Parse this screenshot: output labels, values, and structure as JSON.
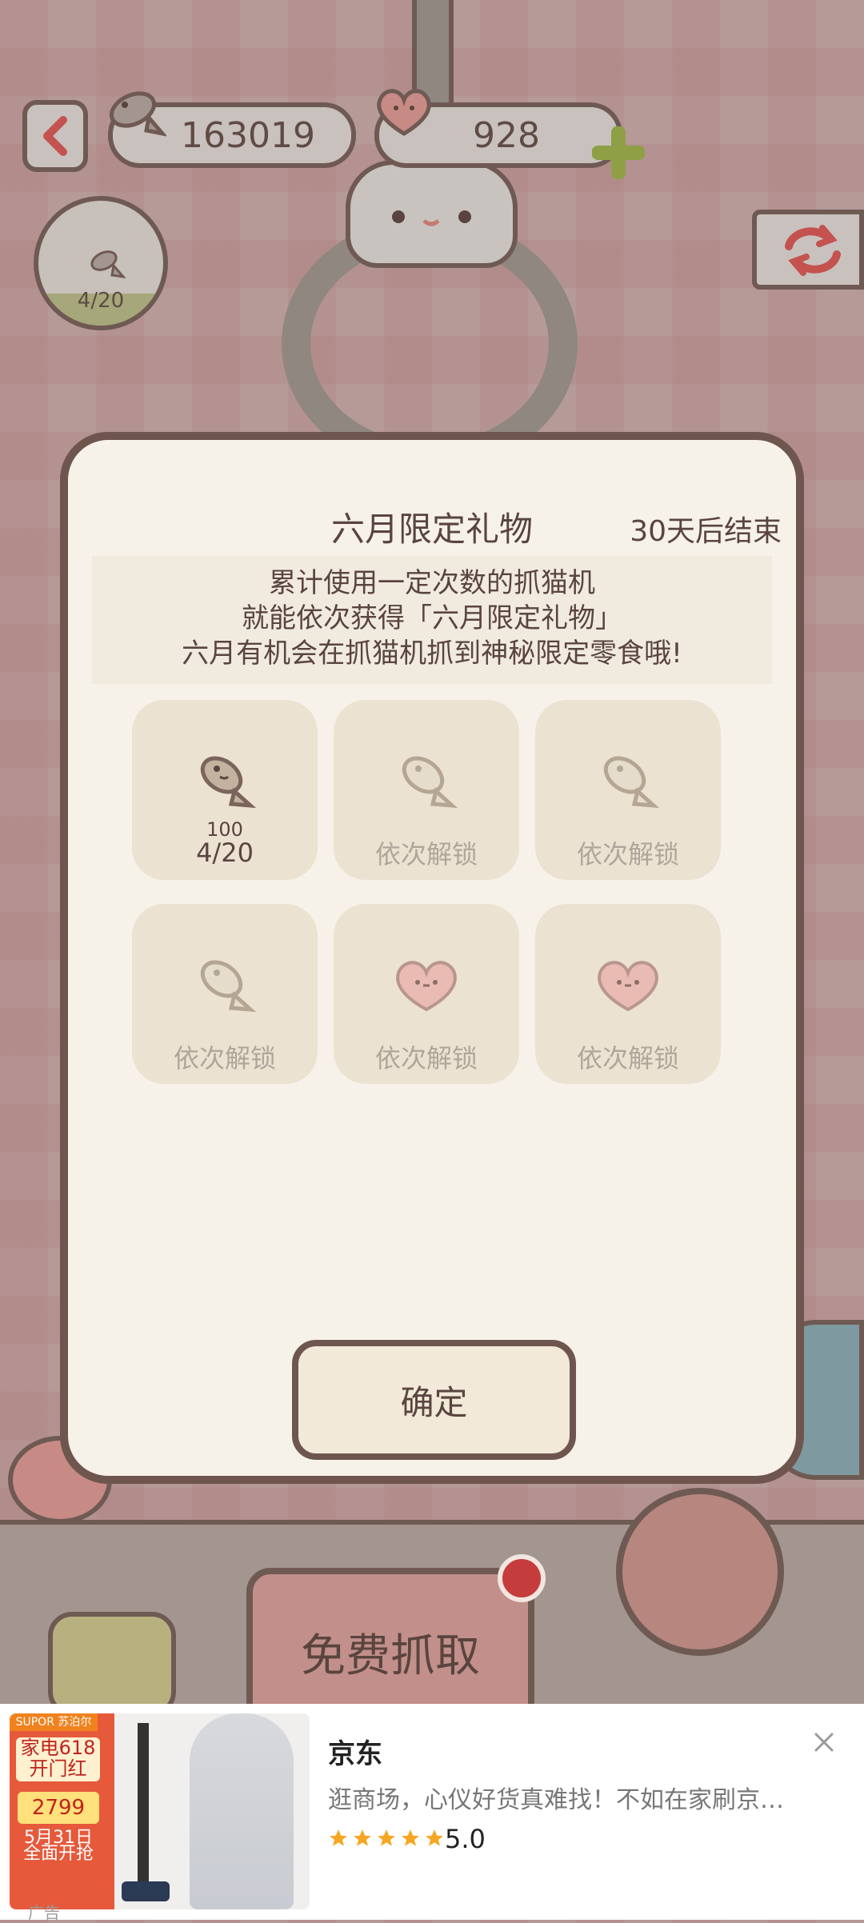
{
  "hud": {
    "fish_count": "163019",
    "heart_count": "928",
    "progress_text": "4/20"
  },
  "modal": {
    "title": "六月限定礼物",
    "timer": "30天后结束",
    "description": [
      "累计使用一定次数的抓猫机",
      "就能依次获得「六月限定礼物」",
      "六月有机会在抓猫机抓到神秘限定零食哦!"
    ],
    "rewards": [
      {
        "icon": "fish-icon",
        "line1": "100",
        "line2": "4/20",
        "state": "active"
      },
      {
        "icon": "fish-icon",
        "locked_label": "依次解锁",
        "state": "locked"
      },
      {
        "icon": "fish-icon",
        "locked_label": "依次解锁",
        "state": "locked"
      },
      {
        "icon": "fish-icon",
        "locked_label": "依次解锁",
        "state": "locked"
      },
      {
        "icon": "heart-snack-icon",
        "locked_label": "依次解锁",
        "state": "locked"
      },
      {
        "icon": "heart-snack-icon",
        "locked_label": "依次解锁",
        "state": "locked"
      }
    ],
    "confirm_label": "确定"
  },
  "game": {
    "free_grab_label": "免费抓取"
  },
  "ad": {
    "title": "京东",
    "text": "逛商场，心仪好货真难找！不如在家刷京…",
    "rating": "5.0",
    "stars": 5,
    "label": "广告",
    "thumb_brand": "SUPOR 苏泊尔",
    "thumb_badge": "家电618 开门红",
    "thumb_price": "2799",
    "thumb_date": "5月31日 全面开抢",
    "colors": {
      "star": "#f5a623",
      "accent": "#e6593b"
    }
  }
}
